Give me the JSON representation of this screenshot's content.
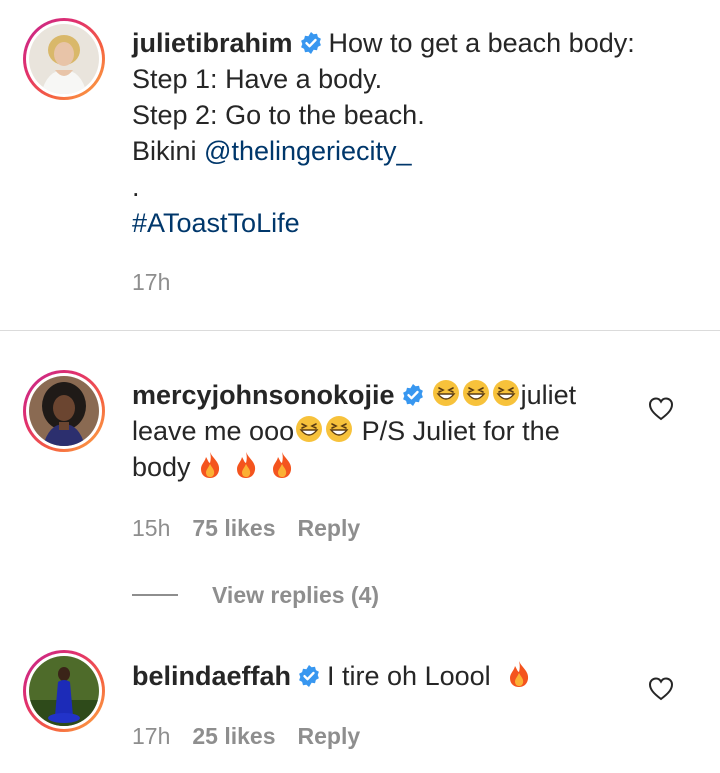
{
  "caption": {
    "username": "julietibrahim",
    "text_line1": "How to get a beach body:",
    "text_line2": "Step 1: Have a body.",
    "text_line3": "Step 2: Go to the beach.",
    "text_line4_prefix": "Bikini ",
    "mention": "@thelingeriecity_",
    "text_line5": ".",
    "hashtag": "#AToastToLife",
    "time": "17h"
  },
  "comments": [
    {
      "username": "mercyjohnsonokojie",
      "text_a": "juliet",
      "text_b": "leave me ooo",
      "text_c": " P/S Juliet for the",
      "text_d": "body",
      "time": "15h",
      "likes": "75 likes",
      "reply": "Reply",
      "view_replies": "View replies (4)"
    },
    {
      "username": "belindaeffah",
      "text": "I tire oh Loool ",
      "time": "17h",
      "likes": "25 likes",
      "reply": "Reply"
    }
  ],
  "colors": {
    "verified": "#3897f0",
    "link": "#00376b",
    "muted": "#8e8e8e",
    "ring_start": "#c3268f",
    "ring_end": "#fcaf45"
  }
}
